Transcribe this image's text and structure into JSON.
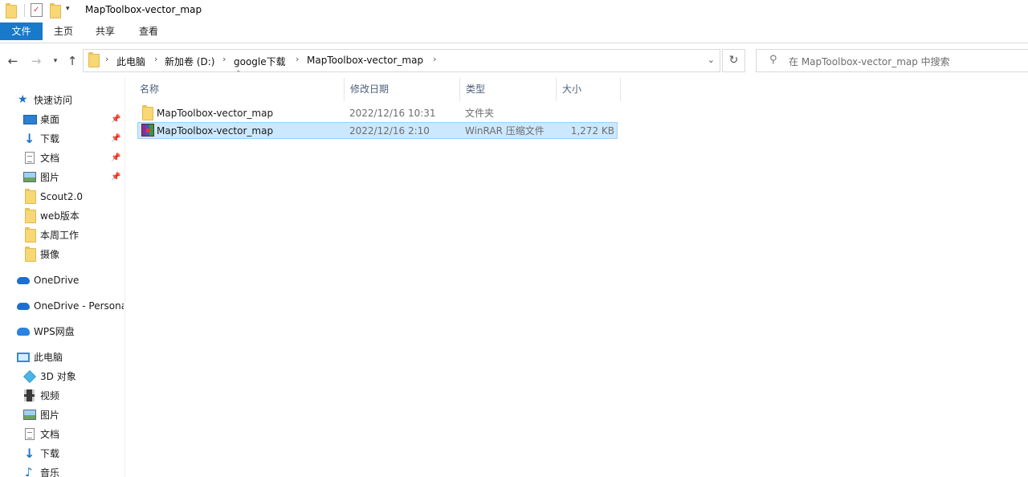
{
  "window": {
    "title": "MapToolbox-vector_map"
  },
  "ribbon": {
    "tabs": [
      {
        "label": "文件",
        "active": true
      },
      {
        "label": "主页"
      },
      {
        "label": "共享"
      },
      {
        "label": "查看"
      }
    ]
  },
  "navigation": {
    "back_icon": "arrow-left-icon",
    "forward_icon": "arrow-right-icon",
    "recent_icon": "chevron-down-icon",
    "up_icon": "arrow-up-icon"
  },
  "address": {
    "crumbs": [
      "此电脑",
      "新加卷 (D:)",
      "google下载",
      "MapToolbox-vector_map"
    ]
  },
  "search": {
    "placeholder": "在 MapToolbox-vector_map 中搜索"
  },
  "sidebar": {
    "quick_access": "快速访问",
    "quick_items": [
      {
        "label": "桌面",
        "icon": "desktop-icon",
        "pinned": true
      },
      {
        "label": "下载",
        "icon": "download-icon",
        "pinned": true
      },
      {
        "label": "文档",
        "icon": "document-icon",
        "pinned": true
      },
      {
        "label": "图片",
        "icon": "picture-icon",
        "pinned": true
      },
      {
        "label": "Scout2.0",
        "icon": "folder-icon"
      },
      {
        "label": "web版本",
        "icon": "folder-icon"
      },
      {
        "label": "本周工作",
        "icon": "folder-icon"
      },
      {
        "label": "摄像",
        "icon": "folder-icon"
      }
    ],
    "onedrive": "OneDrive",
    "onedrive_personal": "OneDrive - Persona",
    "wps": "WPS网盘",
    "this_pc": "此电脑",
    "pc_items": [
      {
        "label": "3D 对象",
        "icon": "3d-objects-icon"
      },
      {
        "label": "视频",
        "icon": "video-icon"
      },
      {
        "label": "图片",
        "icon": "picture-icon"
      },
      {
        "label": "文档",
        "icon": "document-icon"
      },
      {
        "label": "下载",
        "icon": "download-icon"
      },
      {
        "label": "音乐",
        "icon": "music-icon"
      }
    ]
  },
  "files": {
    "columns": [
      "名称",
      "修改日期",
      "类型",
      "大小"
    ],
    "rows": [
      {
        "name": "MapToolbox-vector_map",
        "date": "2022/12/16 10:31",
        "type": "文件夹",
        "size": "",
        "icon": "folder-icon",
        "selected": false
      },
      {
        "name": "MapToolbox-vector_map",
        "date": "2022/12/16 2:10",
        "type": "WinRAR 压缩文件",
        "size": "1,272 KB",
        "icon": "winrar-archive-icon",
        "selected": true
      }
    ]
  },
  "colors": {
    "file_tab": "#1979ca",
    "selection": "#cce8ff",
    "selection_border": "#99d1ff",
    "header_text": "#4c607a"
  }
}
